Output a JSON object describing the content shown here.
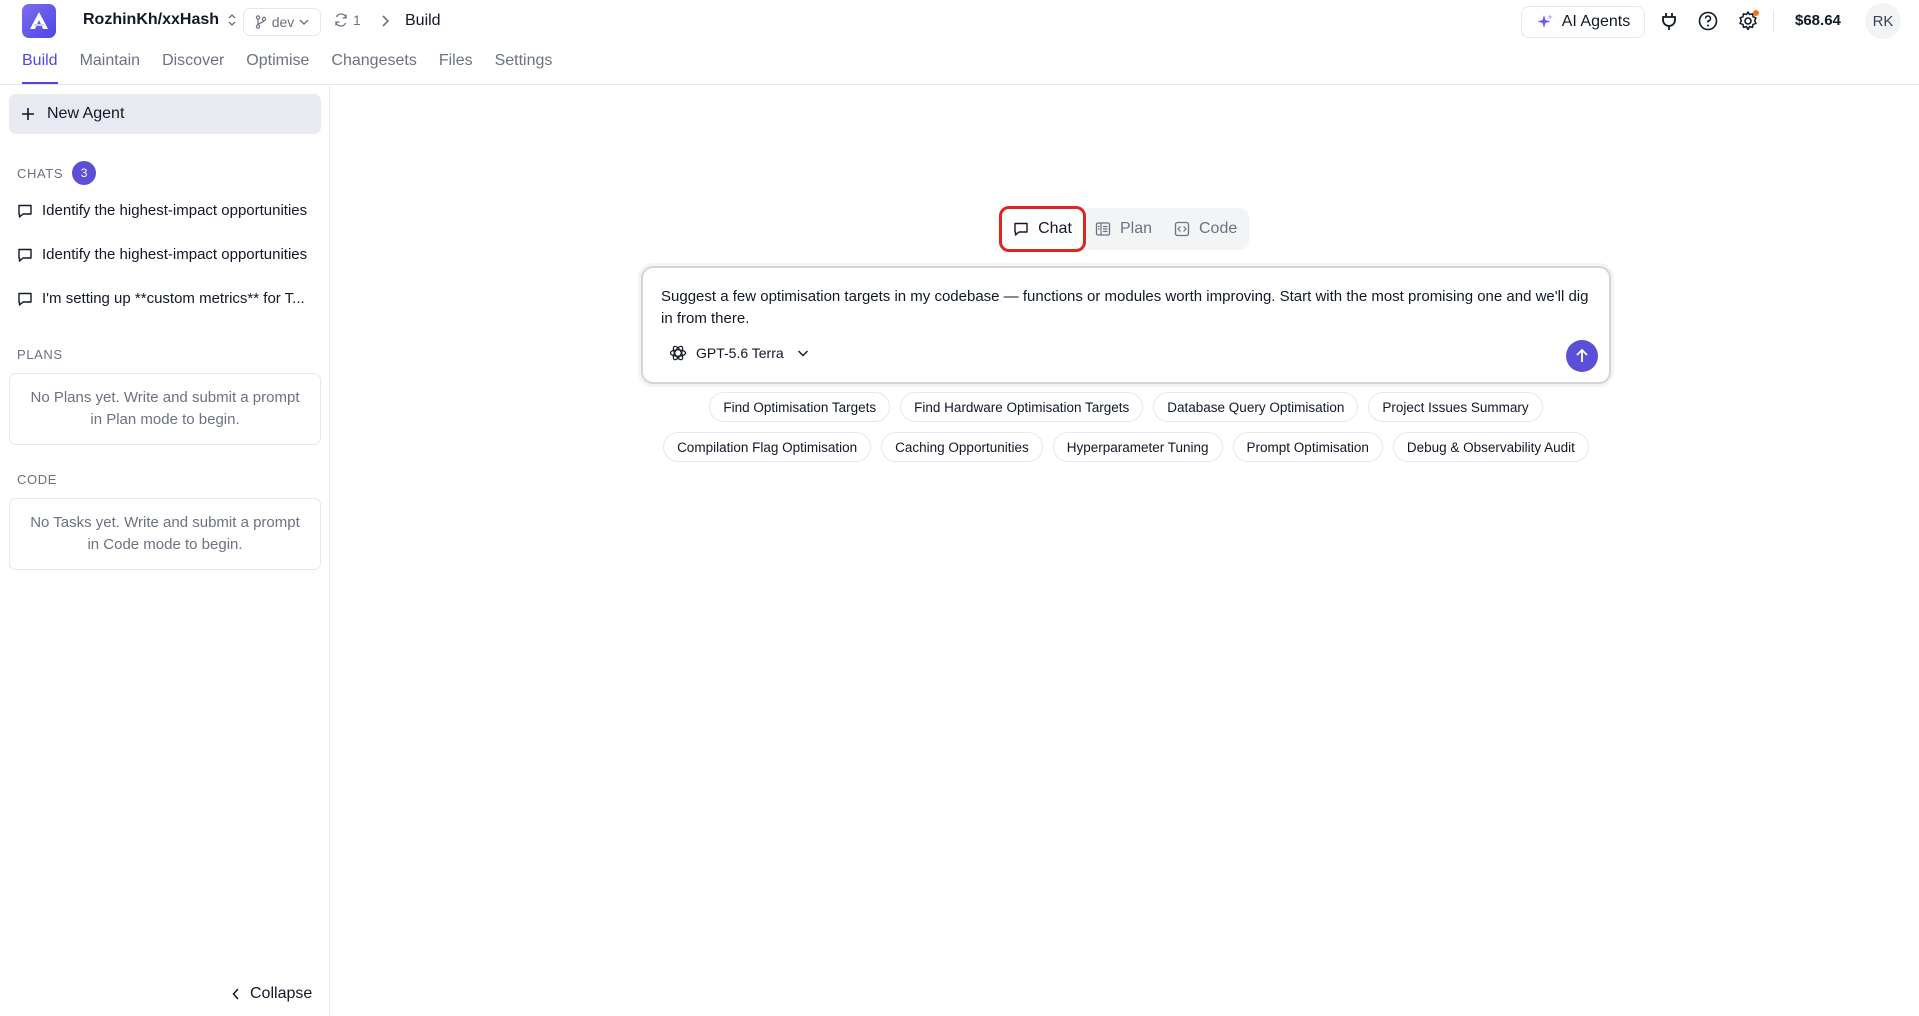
{
  "header": {
    "repo_name": "RozhinKh/xxHash",
    "branch": "dev",
    "sync_count": "1",
    "breadcrumb": "Build",
    "ai_agents_label": "AI Agents",
    "balance": "$68.64",
    "avatar_initials": "RK"
  },
  "nav": {
    "tabs": [
      {
        "label": "Build",
        "active": true
      },
      {
        "label": "Maintain"
      },
      {
        "label": "Discover"
      },
      {
        "label": "Optimise"
      },
      {
        "label": "Changesets"
      },
      {
        "label": "Files"
      },
      {
        "label": "Settings"
      }
    ]
  },
  "sidebar": {
    "new_agent_label": "New Agent",
    "chats_title": "CHATS",
    "chats_count": "3",
    "chats": [
      "Identify the highest-impact opportunities",
      "Identify the highest-impact opportunities",
      "I'm setting up **custom metrics** for T..."
    ],
    "plans_title": "PLANS",
    "plans_empty": "No Plans yet. Write and submit a prompt in Plan mode to begin.",
    "code_title": "CODE",
    "code_empty": "No Tasks yet. Write and submit a prompt in Code mode to begin.",
    "collapse_label": "Collapse"
  },
  "modes": {
    "chat": "Chat",
    "plan": "Plan",
    "code": "Code",
    "active": "Chat"
  },
  "composer": {
    "prompt": "Suggest a few optimisation targets in my codebase — functions or modules worth improving. Start with the most promising one and we'll dig in from there.",
    "model": "GPT-5.6 Terra"
  },
  "suggestions": {
    "row1": [
      "Find Optimisation Targets",
      "Find Hardware Optimisation Targets",
      "Database Query Optimisation",
      "Project Issues Summary"
    ],
    "row2": [
      "Compilation Flag Optimisation",
      "Caching Opportunities",
      "Hyperparameter Tuning",
      "Prompt Optimisation",
      "Debug & Observability Audit"
    ]
  },
  "colors": {
    "accent": "#4f46e5",
    "badge": "#5b4fd8",
    "highlight_border": "#dc2626",
    "notification_dot": "#f97316"
  }
}
